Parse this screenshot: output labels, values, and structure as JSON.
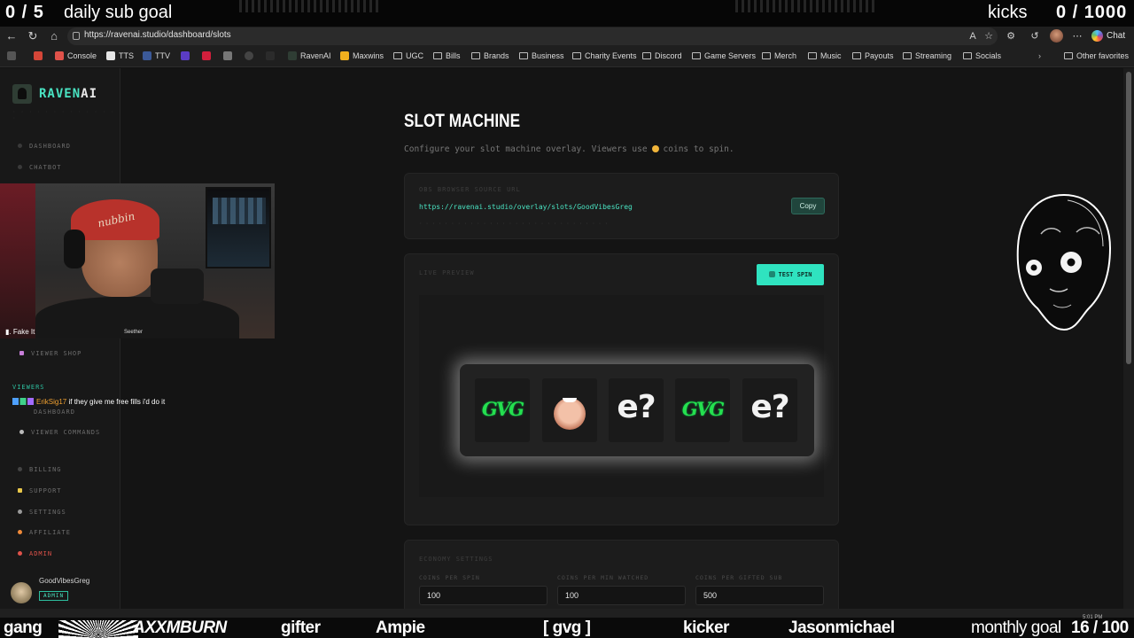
{
  "stream_overlay": {
    "left_counter": "0 / 5",
    "left_goal": "daily sub goal",
    "right_goal": "kicks",
    "right_counter": "0 / 1000"
  },
  "browser": {
    "url": "https://ravenai.studio/dashboard/slots",
    "chat_label": "Chat",
    "bookmarks": [
      {
        "label": "Console"
      },
      {
        "label": "TTS"
      },
      {
        "label": "TTV"
      },
      {
        "label": "RavenAI"
      },
      {
        "label": "Maxwins"
      },
      {
        "label": "UGC"
      },
      {
        "label": "Bills"
      },
      {
        "label": "Brands"
      },
      {
        "label": "Business"
      },
      {
        "label": "Charity Events"
      },
      {
        "label": "Discord"
      },
      {
        "label": "Game Servers"
      },
      {
        "label": "Merch"
      },
      {
        "label": "Music"
      },
      {
        "label": "Payouts"
      },
      {
        "label": "Streaming"
      },
      {
        "label": "Socials"
      }
    ],
    "other_favorites": "Other favorites"
  },
  "sidebar": {
    "brand_left": "RAVEN",
    "brand_right": "AI",
    "items": [
      {
        "label": "DASHBOARD"
      },
      {
        "label": "CHATBOT"
      },
      {
        "label": "VIEWER SHOP"
      },
      {
        "label": "DASHBOARD"
      },
      {
        "label": "VIEWER COMMANDS"
      },
      {
        "label": "BILLING"
      },
      {
        "label": "SUPPORT"
      },
      {
        "label": "SETTINGS"
      },
      {
        "label": "AFFILIATE"
      },
      {
        "label": "ADMIN"
      }
    ],
    "section_viewers": "VIEWERS",
    "user_name": "GoodVibesGreg",
    "user_role": "ADMIN"
  },
  "main": {
    "title": "SLOT MACHINE",
    "subtitle_before": "Configure your slot machine overlay. Viewers use",
    "subtitle_after": "coins to spin.",
    "obs_label": "OBS BROWSER SOURCE URL",
    "obs_url": "https://ravenai.studio/overlay/slots/GoodVibesGreg",
    "copy_label": "Copy",
    "preview_label": "LIVE PREVIEW",
    "test_spin_label": "TEST SPIN",
    "reels": [
      "GVG",
      "face",
      "e?",
      "GVG",
      "e?"
    ],
    "gvg_text": "GVG",
    "e_text": "e?",
    "economy_label": "ECONOMY SETTINGS",
    "fields": [
      {
        "label": "COINS PER SPIN",
        "value": "100"
      },
      {
        "label": "COINS PER MIN WATCHED",
        "value": "100"
      },
      {
        "label": "COINS PER GIFTED SUB",
        "value": "500"
      }
    ]
  },
  "webcam": {
    "name_label": "Fake It",
    "song_label": "Seether",
    "cap_text": "nubbin"
  },
  "chat": {
    "user": "ErikSig17",
    "message": "if they give me free fills i'd do it"
  },
  "ticker": {
    "items": [
      "gang",
      "AXXMBURN",
      "gifter",
      "Ampie",
      "[ gvg ]",
      "kicker",
      "Jasonmichael",
      "monthly goal",
      "16 / 100"
    ]
  },
  "clock": "5:01 PM",
  "colors": {
    "accent": "#49e3c2",
    "button": "#2fe3c0",
    "gvg_green": "#25e04f",
    "coin": "#f0b43a",
    "admin_red": "#e0524a"
  }
}
